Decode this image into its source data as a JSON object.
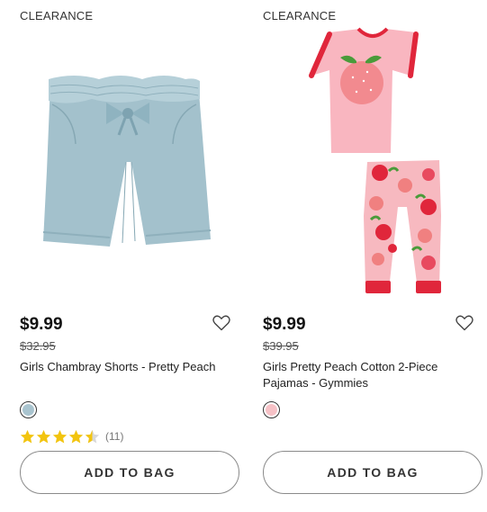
{
  "products": [
    {
      "badge": "CLEARANCE",
      "image_icon": "chambray-shorts-image",
      "price": "$9.99",
      "original_price": "$32.95",
      "name": "Girls Chambray Shorts - Pretty Peach",
      "swatch_color": "#a9c4cf",
      "rating": 4.5,
      "review_count": "(11)",
      "add_label": "ADD TO BAG"
    },
    {
      "badge": "CLEARANCE",
      "image_icon": "peach-pajamas-image",
      "price": "$9.99",
      "original_price": "$39.95",
      "name": "Girls Pretty Peach Cotton 2-Piece Pajamas - Gymmies",
      "swatch_color": "#f6c1c6",
      "add_label": "ADD TO BAG"
    }
  ],
  "colors": {
    "star": "#f2c40f",
    "star_empty": "#d8d8d8",
    "button_border": "#8a8a8a"
  }
}
